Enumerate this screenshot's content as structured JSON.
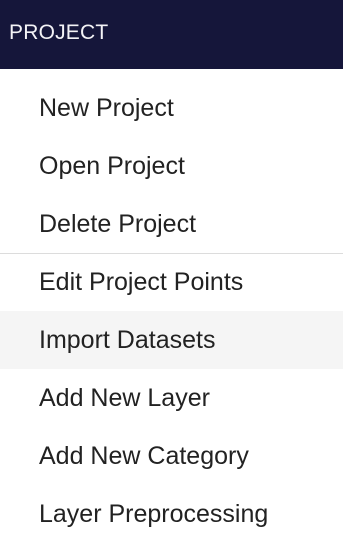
{
  "panel": {
    "title": "PROJECT"
  },
  "menu": {
    "items": [
      {
        "label": "New Project"
      },
      {
        "label": "Open Project"
      },
      {
        "label": "Delete Project"
      },
      {
        "label": "Edit Project Points"
      },
      {
        "label": "Import Datasets"
      },
      {
        "label": "Add New Layer"
      },
      {
        "label": "Add New Category"
      },
      {
        "label": "Layer Preprocessing"
      }
    ]
  },
  "colors": {
    "header_background": "#15163a",
    "header_text": "#f3f3f6",
    "item_text": "#222222",
    "active_item_background": "#f5f5f5",
    "divider": "#dcdcdc"
  }
}
